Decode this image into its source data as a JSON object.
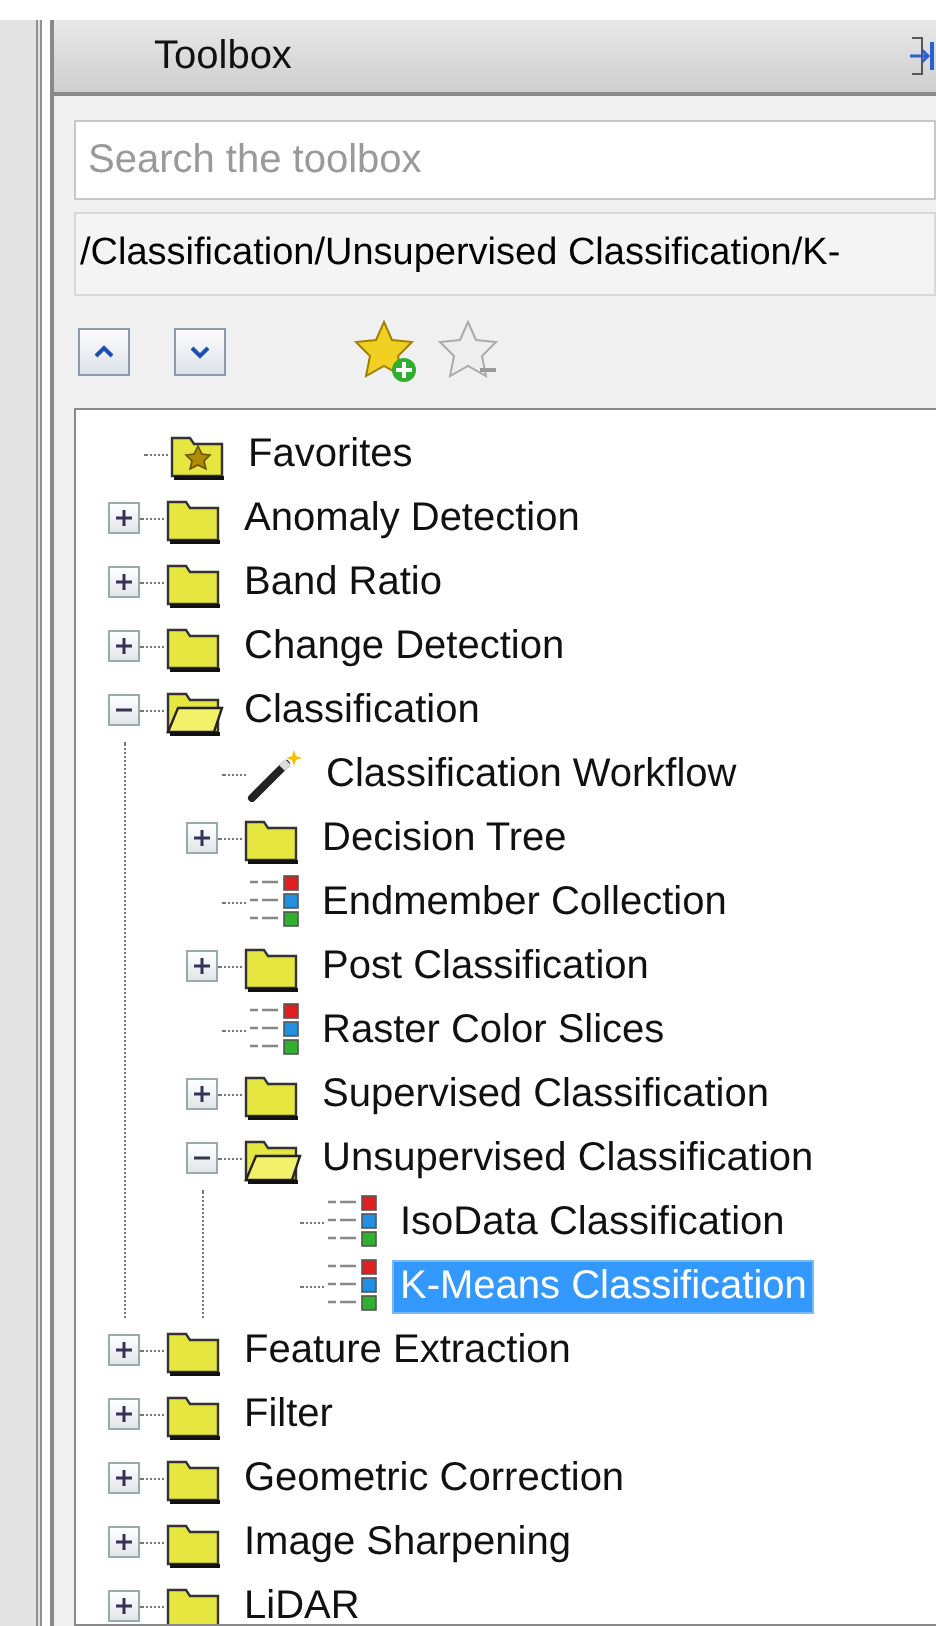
{
  "panel": {
    "title": "Toolbox"
  },
  "search": {
    "placeholder": "Search the toolbox"
  },
  "path": {
    "value": "/Classification/Unsupervised Classification/K-"
  },
  "tree": [
    {
      "kind": "favorites",
      "label": "Favorites",
      "selected": false
    },
    {
      "kind": "folder",
      "label": "Anomaly Detection",
      "expanded": false,
      "selected": false
    },
    {
      "kind": "folder",
      "label": "Band Ratio",
      "expanded": false,
      "selected": false
    },
    {
      "kind": "folder",
      "label": "Change Detection",
      "expanded": false,
      "selected": false
    },
    {
      "kind": "folder",
      "label": "Classification",
      "expanded": true,
      "selected": false,
      "children": [
        {
          "kind": "wand",
          "label": "Classification Workflow",
          "selected": false
        },
        {
          "kind": "folder",
          "label": "Decision Tree",
          "expanded": false,
          "selected": false
        },
        {
          "kind": "tool",
          "label": "Endmember Collection",
          "selected": false
        },
        {
          "kind": "folder",
          "label": "Post Classification",
          "expanded": false,
          "selected": false
        },
        {
          "kind": "tool",
          "label": "Raster Color Slices",
          "selected": false
        },
        {
          "kind": "folder",
          "label": "Supervised Classification",
          "expanded": false,
          "selected": false
        },
        {
          "kind": "folder",
          "label": "Unsupervised Classification",
          "expanded": true,
          "selected": false,
          "children": [
            {
              "kind": "tool",
              "label": "IsoData Classification",
              "selected": false
            },
            {
              "kind": "tool",
              "label": "K-Means Classification",
              "selected": true
            }
          ]
        }
      ]
    },
    {
      "kind": "folder",
      "label": "Feature Extraction",
      "expanded": false,
      "selected": false
    },
    {
      "kind": "folder",
      "label": "Filter",
      "expanded": false,
      "selected": false
    },
    {
      "kind": "folder",
      "label": "Geometric Correction",
      "expanded": false,
      "selected": false
    },
    {
      "kind": "folder",
      "label": "Image Sharpening",
      "expanded": false,
      "selected": false
    },
    {
      "kind": "folder",
      "label": "LiDAR",
      "expanded": false,
      "selected": false
    }
  ]
}
